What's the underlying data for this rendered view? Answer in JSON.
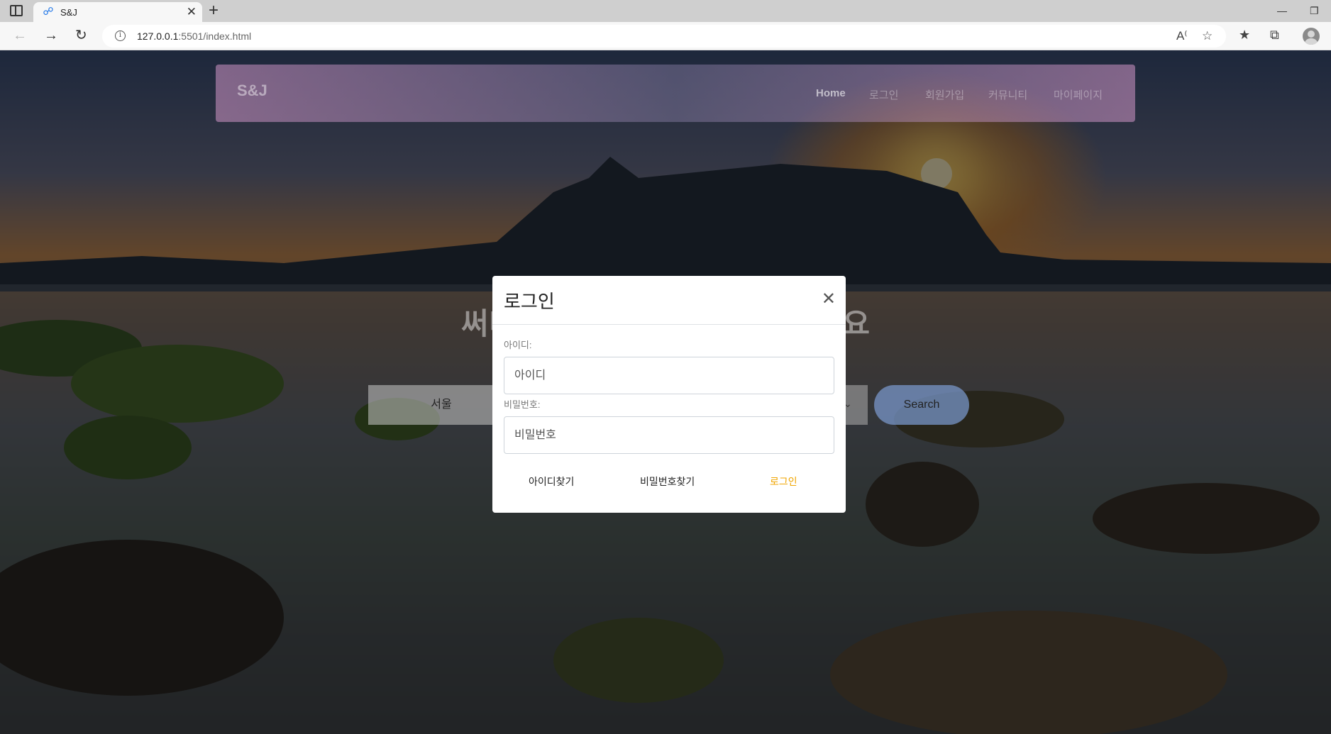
{
  "browser": {
    "tab_title": "S&J",
    "url_host": "127.0.0.1",
    "url_path": ":5501/index.html"
  },
  "site": {
    "brand": "S&J",
    "nav": [
      "Home",
      "로그인",
      "회원가입",
      "커뮤니티",
      "마이페이지"
    ],
    "hero_title": "써니 제주에서 숙소를 검색하세요",
    "region_select": "서울",
    "search_button": "Search"
  },
  "login_modal": {
    "title": "로그인",
    "id_label": "아이디:",
    "id_placeholder": "아이디",
    "pw_label": "비밀번호:",
    "pw_placeholder": "비밀번호",
    "find_id": "아이디찾기",
    "find_pw": "비밀번호찾기",
    "login_button": "로그인"
  },
  "colors": {
    "login_accent": "#f0a500",
    "modal_bg": "#ffffff"
  }
}
